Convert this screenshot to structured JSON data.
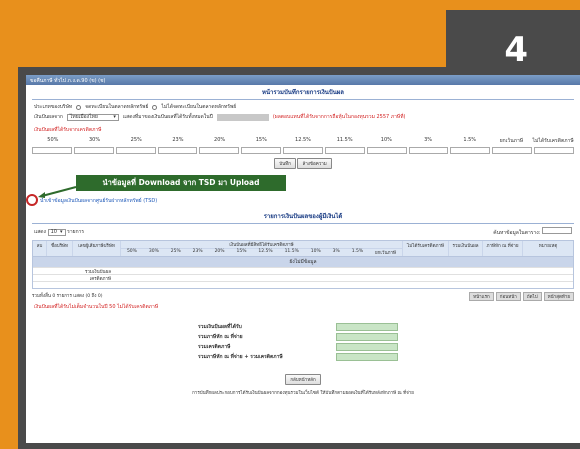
{
  "step": "4",
  "window": {
    "title": "ขอคืนภาษี ทั่วไป ภ.ง.ด.90 (ข) (ช)"
  },
  "section_title": "หน้ารวมบันทึกรายการเงินปันผล",
  "option_row": {
    "label": "ประเภทของบริษัท",
    "opt1": "จดทะเบียนในตลาดหลักทรัพย์",
    "opt2": "ไม่ได้จดทะเบียนในตลาดหลักทรัพย์"
  },
  "income_row": {
    "label": "เงินปันผลจาก",
    "select_value": "ไทยเมืองไทย",
    "label2": "แสดงที่มาของเงินปันผลที่ได้รับทั้งหมดในปี",
    "note": "(ผลตอบแทนที่ได้รับจากการถือหุ้นในกองทุนรวม 2557 ภาษีที่)"
  },
  "rate_title": "เงินปันผลที่ได้รับจากเครดิตภาษี",
  "rates": [
    "50%",
    "30%",
    "25%",
    "23%",
    "20%",
    "15%",
    "12.5%",
    "11.5%",
    "10%",
    "3%",
    "1.5%",
    "ยกเว้นภาษี",
    "ไม่ได้รับเครดิตภาษี"
  ],
  "buttons": {
    "save": "บันทึก",
    "clear": "ล้างข้อความ"
  },
  "callout": "นำข้อมูลที่ Download จาก TSD มา Upload",
  "link": "นำเข้าข้อมูลเงินปันผลจากศูนย์รับฝากหลักทรัพย์ (TSD)",
  "list_title": "รายการเงินปันผลของผู้มีเงินได้",
  "list_controls": {
    "show": "แสดง",
    "show_value": "10",
    "items": "รายการ",
    "search": "ค้นหาข้อมูลในตาราง:"
  },
  "table_headers": [
    "ลบ",
    "ชื่อบริษัท",
    "เลขผู้เสียภาษีบริษัท",
    "เงินปันผลที่มีสิทธิได้รับเครดิตภาษี",
    "50%",
    "30%",
    "25%",
    "23%",
    "20%",
    "15%",
    "12.5%",
    "11.5%",
    "10%",
    "3%",
    "1.5%",
    "ยกเว้นภาษี",
    "ไม่ได้รับเครดิตภาษี",
    "รวมเงินปันผล",
    "ภาษีหัก ณ ที่จ่าย",
    "หมายเหตุ"
  ],
  "no_data": "ยังไม่มีข้อมูล",
  "row_labels": [
    "รวมเงินปันผล",
    "เครดิตภาษี"
  ],
  "pager": {
    "summary": "รวมทั้งสิ้น 0 รายการ แสดง (0 ถึง 0)",
    "note": "เงินปันผลที่ได้รับไม่เต็มจำนวนในปี 50 ไม่ได้รับเครดิตภาษี",
    "first": "หน้าแรก",
    "prev": "ก่อนหน้า",
    "next": "ถัดไป",
    "last": "หน้าสุดท้าย"
  },
  "summary": [
    "รวมเงินปันผลที่ได้รับ",
    "รวมภาษีหัก ณ ที่จ่าย",
    "รวมเครดิตภาษี",
    "รวมภาษีหัก ณ ที่จ่าย + รวมเครดิตภาษี"
  ],
  "back_button": "กลับหน้าหลัก",
  "footer_note": "การบันทึกผลประกอบการได้รับเงินปันผลจากกองทุนรวมในเว็บไซต์ ให้บันทึกตามยอดเงินที่ได้รับหลังหักภาษี ณ ที่จ่าย"
}
